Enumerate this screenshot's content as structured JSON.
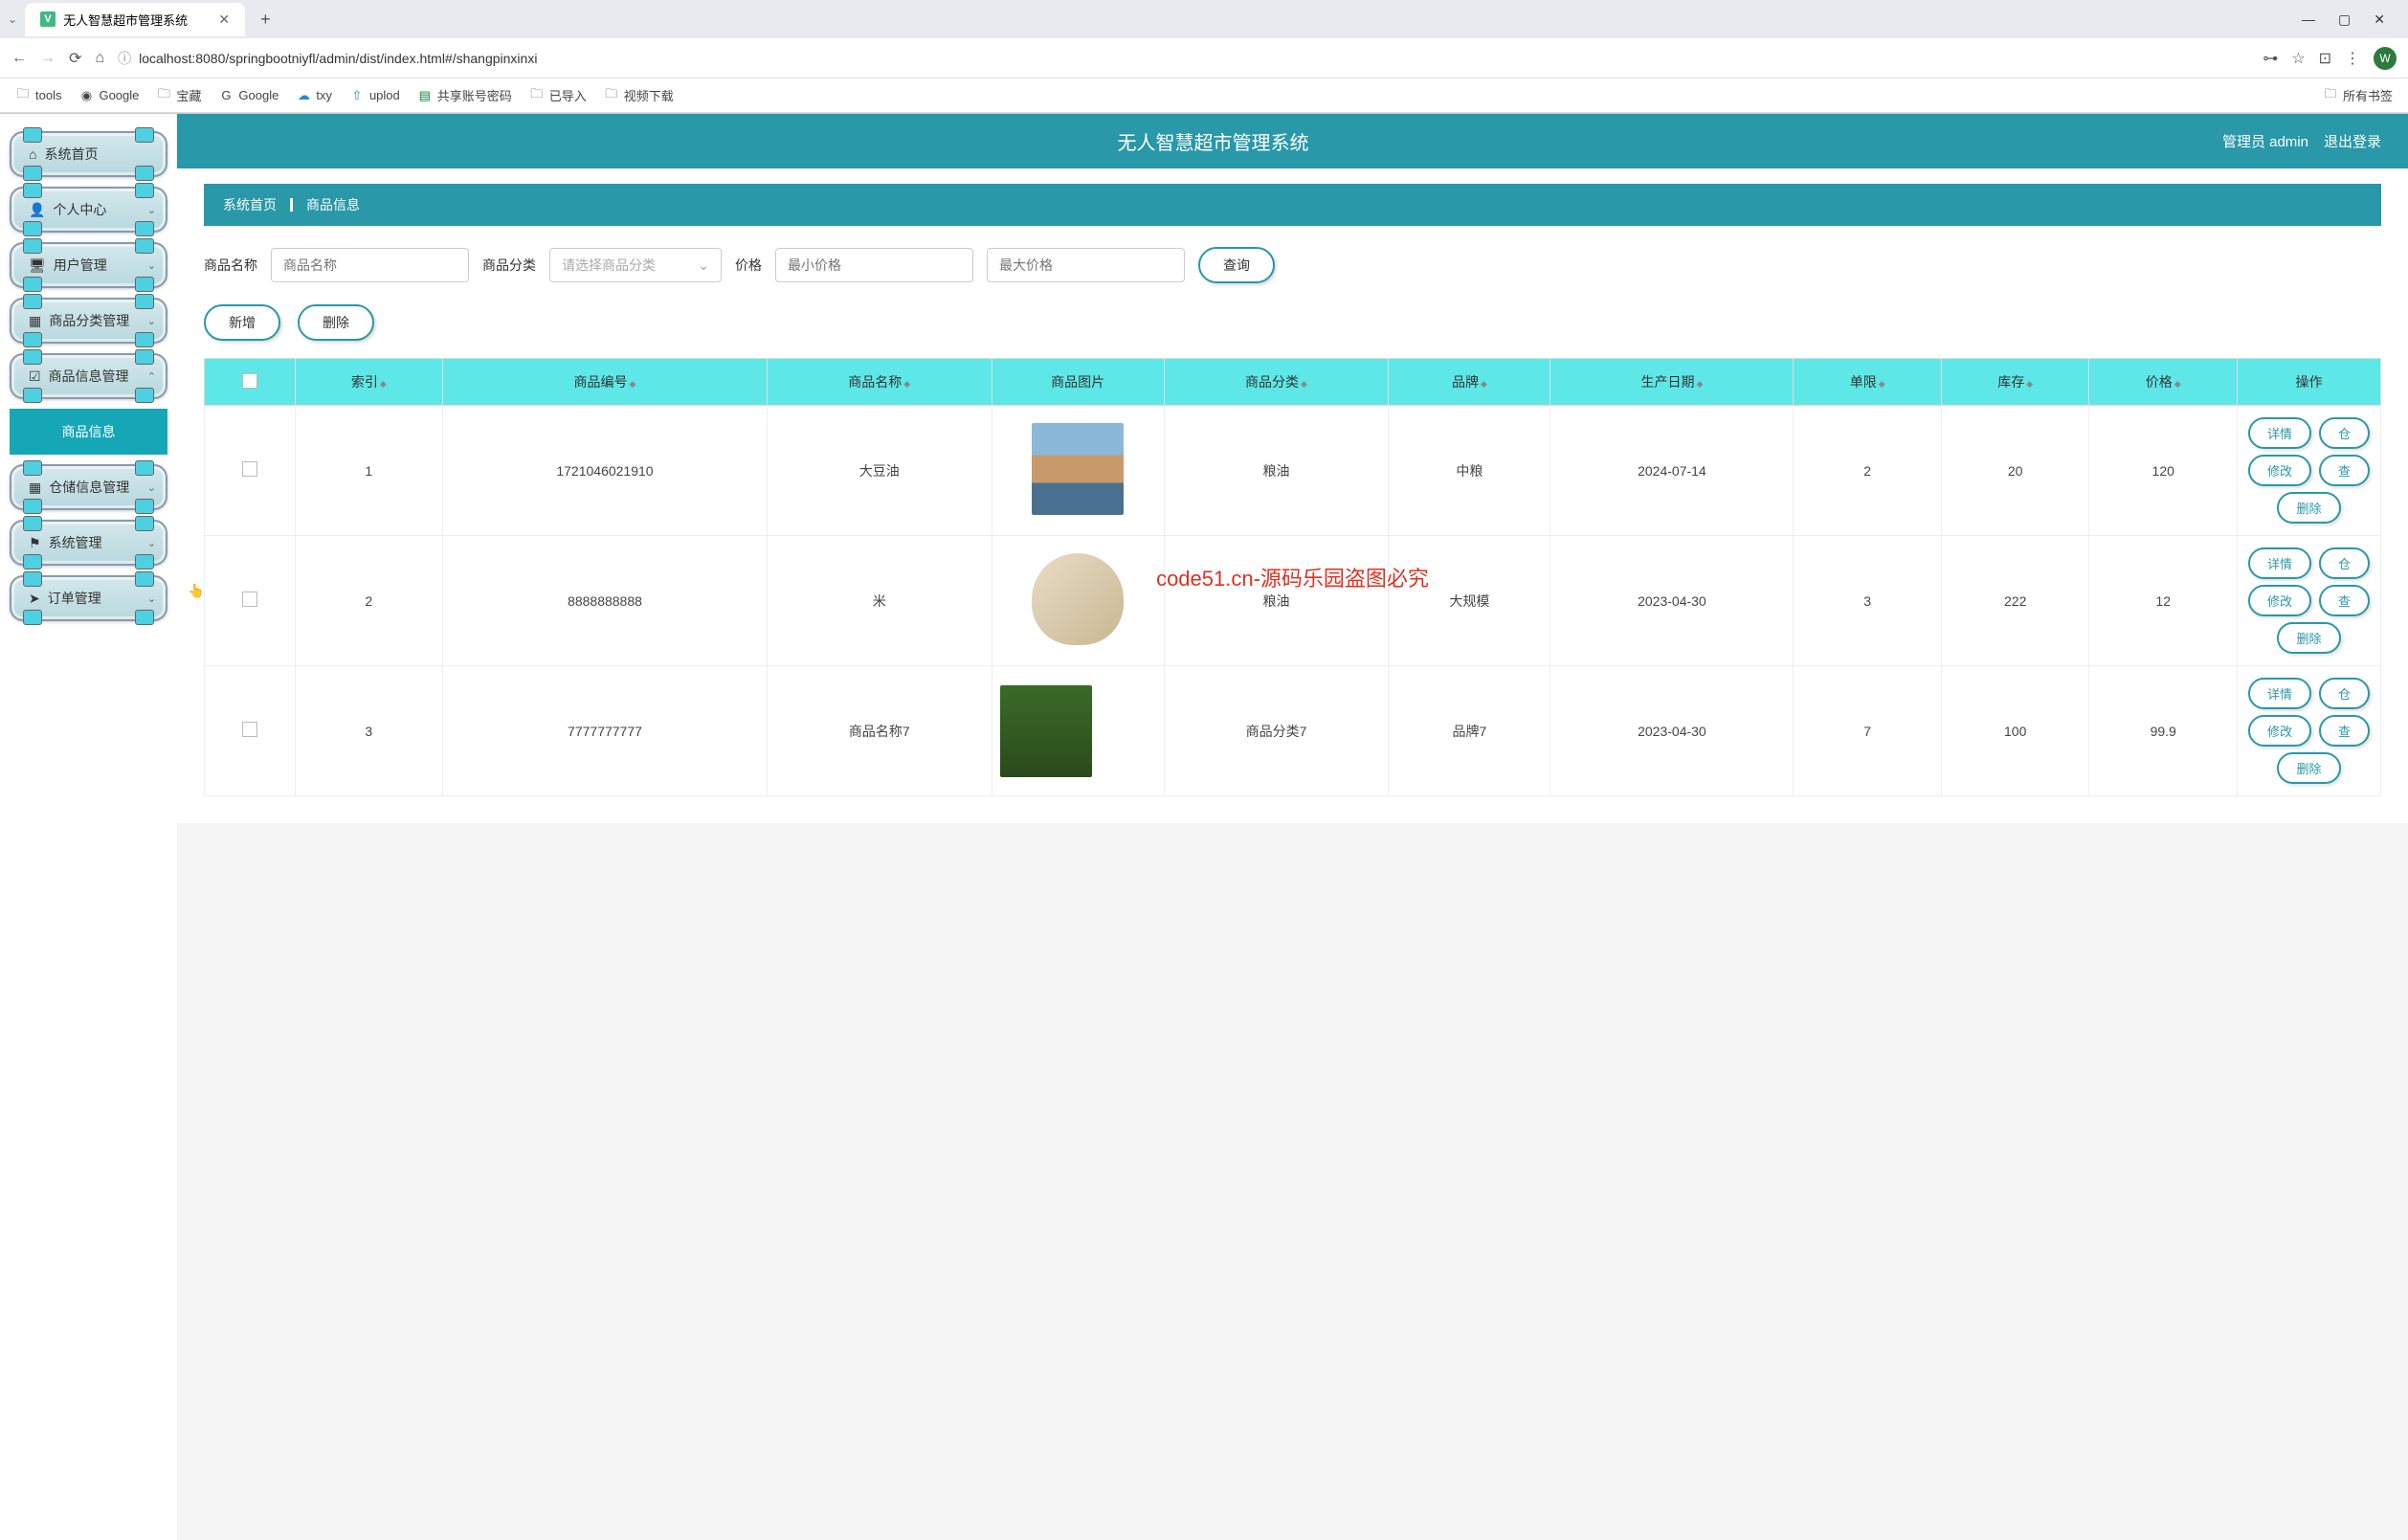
{
  "browser": {
    "tab_title": "无人智慧超市管理系统",
    "url": "localhost:8080/springbootniyfl/admin/dist/index.html#/shangpinxinxi",
    "bookmarks": [
      "tools",
      "Google",
      "宝藏",
      "Google",
      "txy",
      "uplod",
      "共享账号密码",
      "已导入",
      "视频下载"
    ],
    "bookmarks_right": "所有书签"
  },
  "header": {
    "title": "无人智慧超市管理系统",
    "user_prefix": "管理员",
    "user_name": "admin",
    "logout": "退出登录"
  },
  "sidebar": {
    "items": [
      {
        "icon": "⌂",
        "label": "系统首页",
        "arrow": ""
      },
      {
        "icon": "👤",
        "label": "个人中心",
        "arrow": "⌄"
      },
      {
        "icon": "🖥",
        "label": "用户管理",
        "arrow": "⌄"
      },
      {
        "icon": "▦",
        "label": "商品分类管理",
        "arrow": "⌄"
      },
      {
        "icon": "☑",
        "label": "商品信息管理",
        "arrow": "⌃"
      },
      {
        "icon": "▦",
        "label": "仓储信息管理",
        "arrow": "⌄"
      },
      {
        "icon": "⚑",
        "label": "系统管理",
        "arrow": "⌄"
      },
      {
        "icon": "➤",
        "label": "订单管理",
        "arrow": "⌄"
      }
    ],
    "submenu": "商品信息"
  },
  "breadcrumb": {
    "home": "系统首页",
    "current": "商品信息"
  },
  "filters": {
    "name_label": "商品名称",
    "name_placeholder": "商品名称",
    "cat_label": "商品分类",
    "cat_placeholder": "请选择商品分类",
    "price_label": "价格",
    "min_placeholder": "最小价格",
    "max_placeholder": "最大价格",
    "search_btn": "查询"
  },
  "actions": {
    "add": "新增",
    "delete": "删除"
  },
  "table": {
    "headers": [
      "",
      "索引",
      "商品编号",
      "商品名称",
      "商品图片",
      "商品分类",
      "品牌",
      "生产日期",
      "单限",
      "库存",
      "价格",
      "操作"
    ],
    "rows": [
      {
        "idx": "1",
        "code": "1721046021910",
        "name": "大豆油",
        "cat": "粮油",
        "brand": "中粮",
        "date": "2024-07-14",
        "limit": "2",
        "stock": "20",
        "price": "120"
      },
      {
        "idx": "2",
        "code": "8888888888",
        "name": "米",
        "cat": "粮油",
        "brand": "大规模",
        "date": "2023-04-30",
        "limit": "3",
        "stock": "222",
        "price": "12"
      },
      {
        "idx": "3",
        "code": "7777777777",
        "name": "商品名称7",
        "cat": "商品分类7",
        "brand": "品牌7",
        "date": "2023-04-30",
        "limit": "7",
        "stock": "100",
        "price": "99.9"
      }
    ],
    "row_btns": {
      "detail": "详情",
      "edit": "修改",
      "delete": "删除",
      "stock": "仓",
      "check": "查"
    }
  },
  "watermark": "code51.cn-源码乐园盗图必究",
  "wm_small": "code51.cn"
}
